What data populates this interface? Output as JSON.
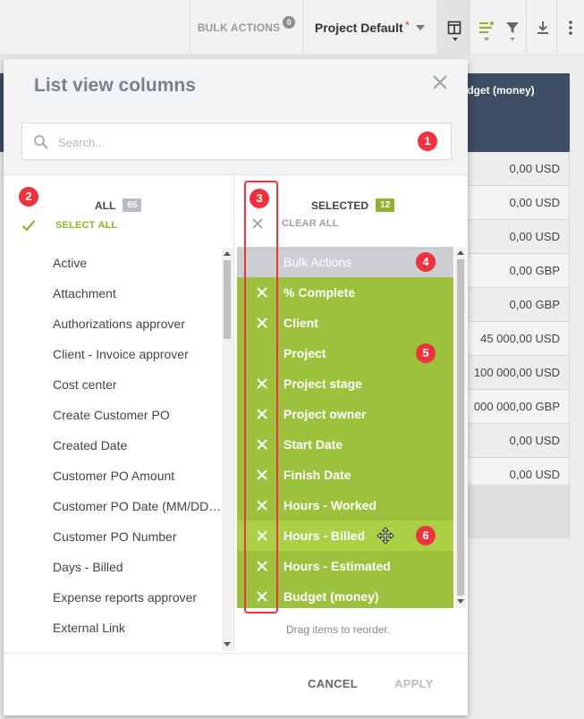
{
  "toolbar": {
    "bulk_actions_label": "BULK ACTIONS",
    "bulk_actions_count": "0",
    "view_label": "Project Default",
    "view_required_mark": "*"
  },
  "background_table": {
    "header": "udget (money)",
    "values": [
      "0,00 USD",
      "0,00 USD",
      "0,00 USD",
      "0,00 GBP",
      "0,00 GBP",
      "45 000,00 USD",
      "100 000,00 USD",
      "000 000,00 GBP",
      "0,00 USD",
      "0,00 USD"
    ]
  },
  "dialog": {
    "title": "List view columns",
    "search_placeholder": "Search...",
    "all_label": "ALL",
    "all_count": "65",
    "select_all_label": "SELECT ALL",
    "selected_label": "SELECTED",
    "selected_count": "12",
    "clear_all_label": "CLEAR ALL",
    "available_columns": [
      "Active",
      "Attachment",
      "Authorizations approver",
      "Client - Invoice approver",
      "Cost center",
      "Create Customer PO",
      "Created Date",
      "Customer PO Amount",
      "Customer PO Date (MM/DD/YYYY)",
      "Customer PO Number",
      "Days - Billed",
      "Expense reports approver",
      "External Link"
    ],
    "selected_columns": [
      {
        "label": "Bulk Actions",
        "removable": false
      },
      {
        "label": "% Complete",
        "removable": true
      },
      {
        "label": "Client",
        "removable": true
      },
      {
        "label": "Project",
        "removable": false
      },
      {
        "label": "Project stage",
        "removable": true
      },
      {
        "label": "Project owner",
        "removable": true
      },
      {
        "label": "Start Date",
        "removable": true
      },
      {
        "label": "Finish Date",
        "removable": true
      },
      {
        "label": "Hours - Worked",
        "removable": true
      },
      {
        "label": "Hours - Billed",
        "removable": true
      },
      {
        "label": "Hours - Estimated",
        "removable": true
      },
      {
        "label": "Budget (money)",
        "removable": true
      }
    ],
    "drag_hint": "Drag items to reorder.",
    "cancel_label": "CANCEL",
    "apply_label": "APPLY"
  },
  "annotation_markers": [
    "1",
    "2",
    "3",
    "4",
    "5",
    "6"
  ],
  "colors": {
    "selected_green": "#9bc13d",
    "hover_green": "#aad046",
    "locked_gray": "#cdced2",
    "marker_red": "#f0323e",
    "accent_green": "#8db32c"
  },
  "icons": [
    "column-layout-icon",
    "list-settings-icon",
    "filter-icon",
    "download-icon",
    "more-vertical-icon",
    "close-icon",
    "search-icon",
    "checkmark-icon",
    "remove-x-icon",
    "move-cursor-icon"
  ]
}
